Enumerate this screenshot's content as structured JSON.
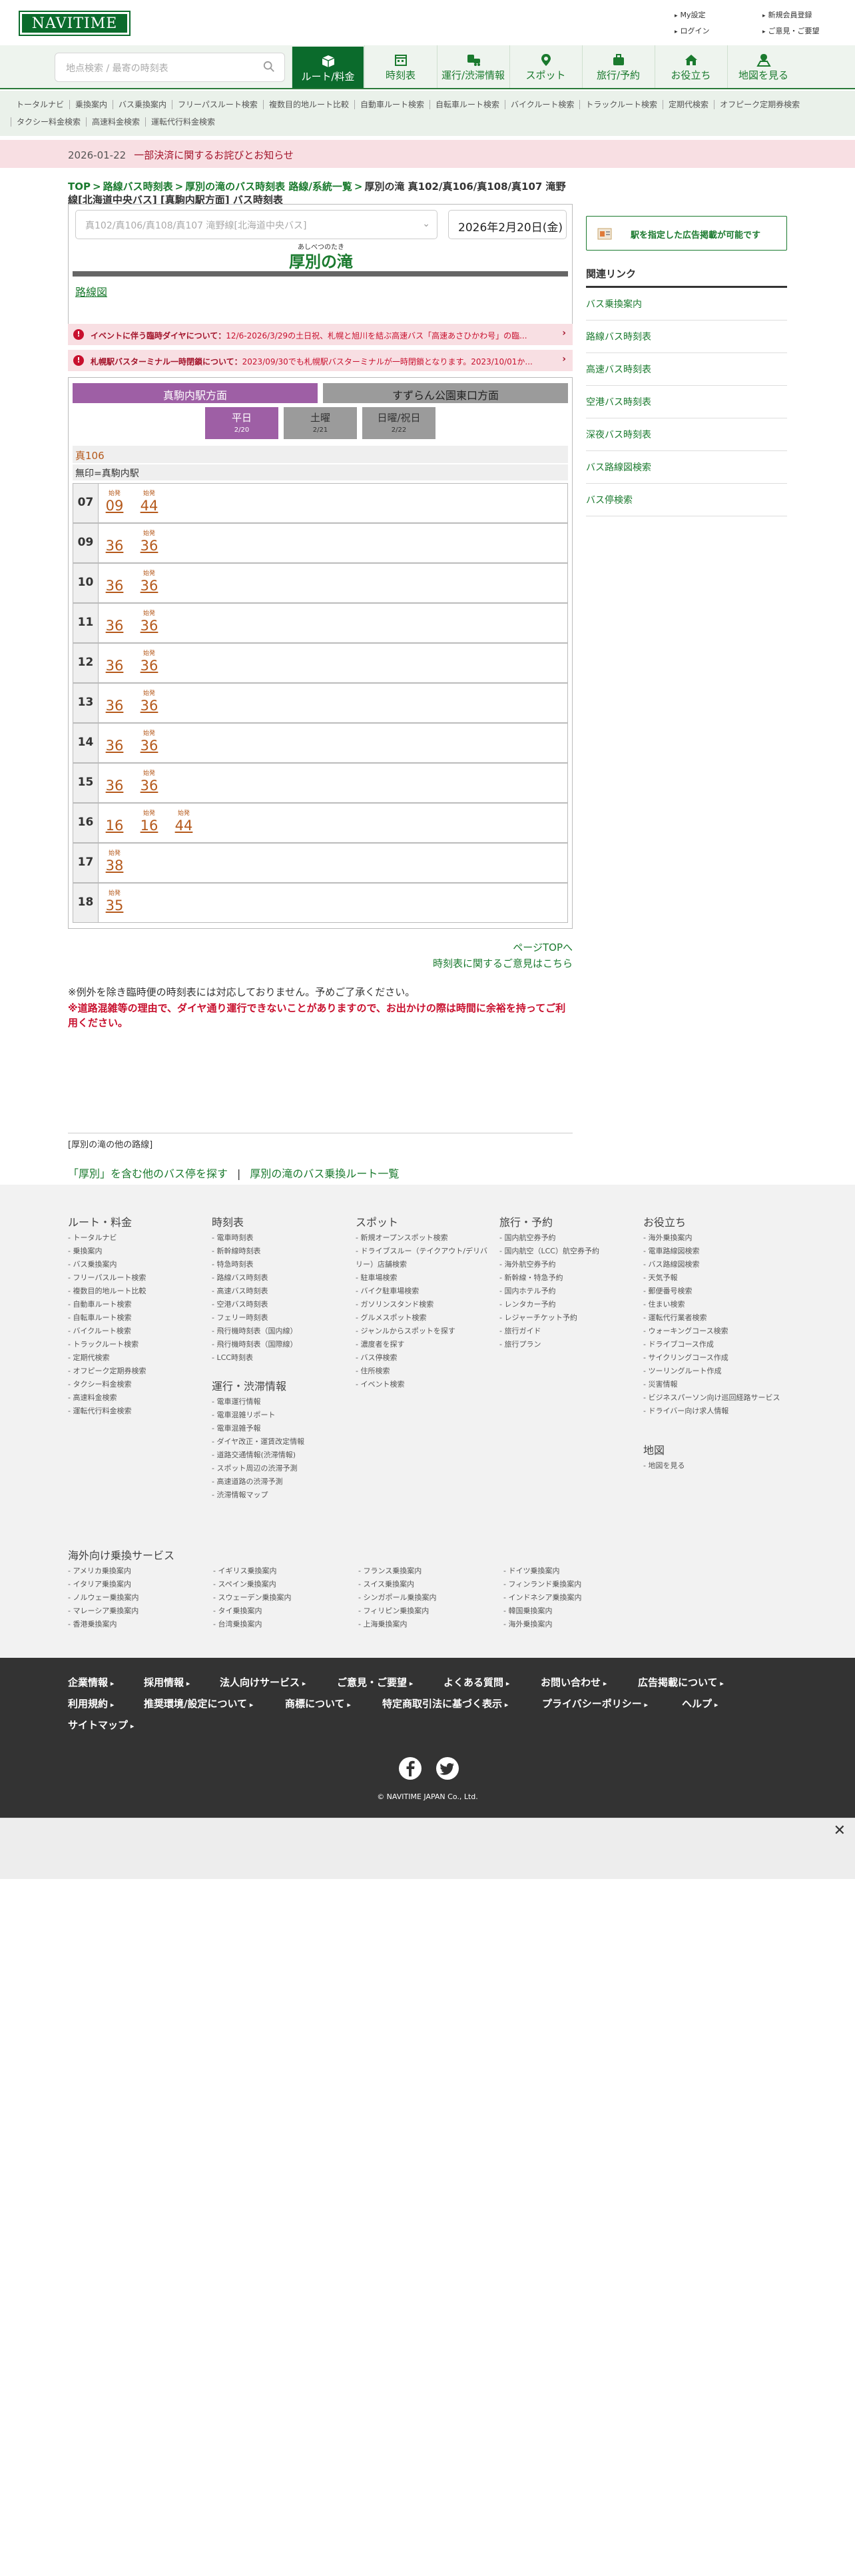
{
  "header": {
    "logo": "NAVITIME",
    "links": [
      "My設定",
      "新規会員登録",
      "ログイン",
      "ご意見・ご要望"
    ]
  },
  "nav": {
    "search_placeholder": "地点検索 / 最寄の時刻表",
    "tabs": [
      "ルート/料金",
      "時刻表",
      "運行/渋滞情報",
      "スポット",
      "旅行/予約",
      "お役立ち",
      "地図を見る"
    ]
  },
  "subnav": [
    "トータルナビ",
    "乗換案内",
    "バス乗換案内",
    "フリーパスルート検索",
    "複数目的地ルート比較",
    "自動車ルート検索",
    "自転車ルート検索",
    "バイクルート検索",
    "トラックルート検索",
    "定期代検索",
    "オフピーク定期券検索",
    "タクシー料金検索",
    "高速料金検索",
    "運転代行料金検索"
  ],
  "notice": {
    "date": "2026-01-22",
    "text": "一部決済に関するお詫びとお知らせ"
  },
  "breadcrumb": {
    "top": "TOP",
    "l1": "路線バス時刻表",
    "l2": "厚別の滝のバス時刻表 路線/系統一覧",
    "current": "厚別の滝 真102/真106/真108/真107 滝野線[北海道中央バス] [真駒内駅方面] バス時刻表"
  },
  "route_box": {
    "route_select": "真102/真106/真108/真107 滝野線[北海道中央バス]",
    "date": "2026年2月20日(金)",
    "stop_ruby": "あしべつのたき",
    "stop_name": "厚別の滝",
    "map_link": "路線図"
  },
  "alerts": [
    {
      "title": "イベントに伴う臨時ダイヤについて：",
      "text": "12/6-2026/3/29の土日祝、札幌と旭川を結ぶ高速バス「高速あさひかわ号」の臨..."
    },
    {
      "title": "札幌駅バスターミナル一時閉鎖について：",
      "text": "2023/09/30でも札幌駅バスターミナルが一時閉鎖となります。2023/10/01か..."
    }
  ],
  "timetable": {
    "directions": [
      "真駒内駅方面",
      "すずらん公園東口方面"
    ],
    "days": [
      {
        "label": "平日",
        "date": "2/20"
      },
      {
        "label": "土曜",
        "date": "2/21"
      },
      {
        "label": "日曜/祝日",
        "date": "2/22"
      }
    ],
    "line": "真106",
    "dest": "無印=真駒内駅",
    "start_label": "始発",
    "rows": [
      {
        "hour": "07",
        "mins": [
          "09",
          "44"
        ]
      },
      {
        "hour": "09",
        "mins": [
          "36",
          "36"
        ]
      },
      {
        "hour": "10",
        "mins": [
          "36",
          "36"
        ]
      },
      {
        "hour": "11",
        "mins": [
          "36",
          "36"
        ]
      },
      {
        "hour": "12",
        "mins": [
          "36",
          "36"
        ]
      },
      {
        "hour": "13",
        "mins": [
          "36",
          "36"
        ]
      },
      {
        "hour": "14",
        "mins": [
          "36",
          "36"
        ]
      },
      {
        "hour": "15",
        "mins": [
          "36",
          "36"
        ]
      },
      {
        "hour": "16",
        "mins": [
          "16",
          "16",
          "44"
        ]
      },
      {
        "hour": "17",
        "mins": [
          "38"
        ]
      },
      {
        "hour": "18",
        "mins": [
          "35"
        ]
      }
    ],
    "start_flags": [
      [
        true,
        true
      ],
      [
        false,
        true
      ],
      [
        false,
        true
      ],
      [
        false,
        true
      ],
      [
        false,
        true
      ],
      [
        false,
        true
      ],
      [
        false,
        true
      ],
      [
        false,
        true
      ],
      [
        false,
        true,
        true
      ],
      [
        true
      ],
      [
        true
      ]
    ]
  },
  "page_links": {
    "top": "ページTOPへ",
    "feedback": "時刻表に関するご意見はこちら"
  },
  "notes": {
    "n1": "※例外を除き臨時便の時刻表には対応しておりません。予めご了承ください。",
    "n2": "※道路混雑等の理由で、ダイヤ通り運行できないことがありますので、お出かけの際は時間に余裕を持ってご利用ください。"
  },
  "other_lines": {
    "title": "[厚別の滝の他の路線]",
    "link1": "「厚別」を含む他のバス停を探す",
    "sep": "|",
    "link2": "厚別の滝のバス乗換ルート一覧"
  },
  "sidebar": {
    "ad": "駅を指定した広告掲載が可能です",
    "related_title": "関連リンク",
    "links": [
      "バス乗換案内",
      "路線バス時刻表",
      "高速バス時刻表",
      "空港バス時刻表",
      "深夜バス時刻表",
      "バス路線図検索",
      "バス停検索"
    ]
  },
  "footer": {
    "cols": [
      {
        "title": "ルート・料金",
        "items": [
          "トータルナビ",
          "乗換案内",
          "バス乗換案内",
          "フリーパスルート検索",
          "複数目的地ルート比較",
          "自動車ルート検索",
          "自転車ルート検索",
          "バイクルート検索",
          "トラックルート検索",
          "定期代検索",
          "オフピーク定期券検索",
          "タクシー料金検索",
          "高速料金検索",
          "運転代行料金検索"
        ]
      },
      {
        "title": "時刻表",
        "items": [
          "電車時刻表",
          "新幹線時刻表",
          "特急時刻表",
          "路線バス時刻表",
          "高速バス時刻表",
          "空港バス時刻表",
          "フェリー時刻表",
          "飛行機時刻表（国内線）",
          "飛行機時刻表（国際線）",
          "LCC時刻表"
        ]
      },
      {
        "title": "スポット",
        "items": [
          "新規オープンスポット検索",
          "ドライブスルー（テイクアウト/デリバリー）店舗検索",
          "駐車場検索",
          "バイク駐車場検索",
          "ガソリンスタンド検索",
          "グルメスポット検索",
          "ジャンルからスポットを探す",
          "濃度者を探す",
          "バス停検索",
          "住所検索",
          "イベント検索"
        ]
      },
      {
        "title": "旅行・予約",
        "items": [
          "国内航空券予約",
          "国内航空（LCC）航空券予約",
          "海外航空券予約",
          "新幹線・特急予約",
          "国内ホテル予約",
          "レンタカー予約",
          "レジャーチケット予約",
          "旅行ガイド",
          "旅行プラン"
        ]
      },
      {
        "title": "お役立ち",
        "items": [
          "海外乗換案内",
          "電車路線図検索",
          "バス路線図検索",
          "天気予報",
          "郵便番号検索",
          "住まい検索",
          "運転代行業者検索",
          "ウォーキングコース検索",
          "ドライブコース作成",
          "サイクリングコース作成",
          "ツーリングルート作成",
          "災害情報",
          "ビジネスパーソン向け巡回経路サービス",
          "ドライバー向け求人情報"
        ]
      },
      {
        "title": "運行・渋滞情報",
        "items": [
          "電車運行情報",
          "電車混雑リポート",
          "電車混雑予報",
          "ダイヤ改正・運賃改定情報",
          "道路交通情報(渋滞情報)",
          "スポット周辺の渋滞予測",
          "高速道路の渋滞予測",
          "渋滞情報マップ"
        ]
      },
      {
        "title": "地図",
        "items": [
          "地図を見る"
        ]
      }
    ],
    "overseas_title": "海外向け乗換サービス",
    "overseas": [
      "アメリカ乗換案内",
      "イギリス乗換案内",
      "フランス乗換案内",
      "ドイツ乗換案内",
      "イタリア乗換案内",
      "スペイン乗換案内",
      "スイス乗換案内",
      "フィンランド乗換案内",
      "ノルウェー乗換案内",
      "スウェーデン乗換案内",
      "シンガポール乗換案内",
      "インドネシア乗換案内",
      "マレーシア乗換案内",
      "タイ乗換案内",
      "フィリピン乗換案内",
      "韓国乗換案内",
      "香港乗換案内",
      "台湾乗換案内",
      "上海乗換案内",
      "海外乗換案内"
    ]
  },
  "dark_footer": {
    "links": [
      "企業情報",
      "採用情報",
      "法人向けサービス",
      "ご意見・ご要望",
      "よくある質問",
      "お問い合わせ",
      "広告掲載について",
      "利用規約",
      "推奨環境/設定について",
      "商標について",
      "特定商取引法に基づく表示",
      "プライバシーポリシー",
      "ヘルプ",
      "サイトマップ"
    ],
    "copyright": "© NAVITIME JAPAN Co., Ltd."
  },
  "colors": {
    "brand": "#0b6b2c",
    "accent": "#1a7a2e",
    "alert": "#c8102e",
    "minute": "#b5591b",
    "weekday": "#9e5fa5"
  }
}
